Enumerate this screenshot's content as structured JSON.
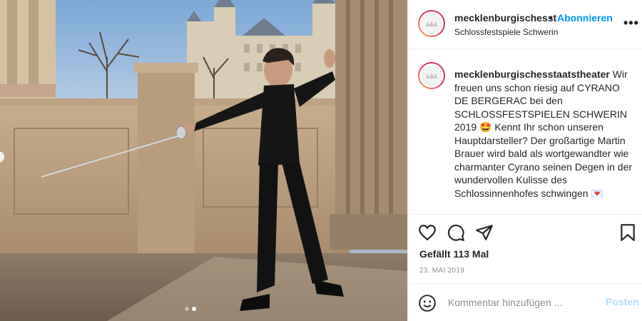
{
  "header": {
    "username": "mecklenburgischesst",
    "follow_label": "Abonnieren",
    "dot": "•",
    "location": "Schlossfestspiele Schwerin",
    "more_label": "•••"
  },
  "caption": {
    "username": "mecklenburgischesstaatstheater",
    "text": " Wir freuen uns schon riesig auf CYRANO DE BERGERAC bei den SCHLOSSFESTSPIELEN SCHWERIN 2019 🤩 Kennt Ihr schon unseren Hauptdarsteller? Der großartige Martin Brauer wird bald als wortgewandter wie charmanter Cyrano seinen Degen in der wundervollen Kulisse des Schlossinnenhofes schwingen 💌"
  },
  "engagement": {
    "likes": "Gefällt 113 Mal",
    "date": "23. MAI 2019"
  },
  "comment": {
    "placeholder": "Kommentar hinzufügen ...",
    "post_label": "Posten"
  },
  "carousel": {
    "slides": 2,
    "active": 2
  },
  "colors": {
    "link": "#0095f6",
    "text": "#262626",
    "muted": "#8e8e8e",
    "post_disabled": "#b2dffc"
  }
}
